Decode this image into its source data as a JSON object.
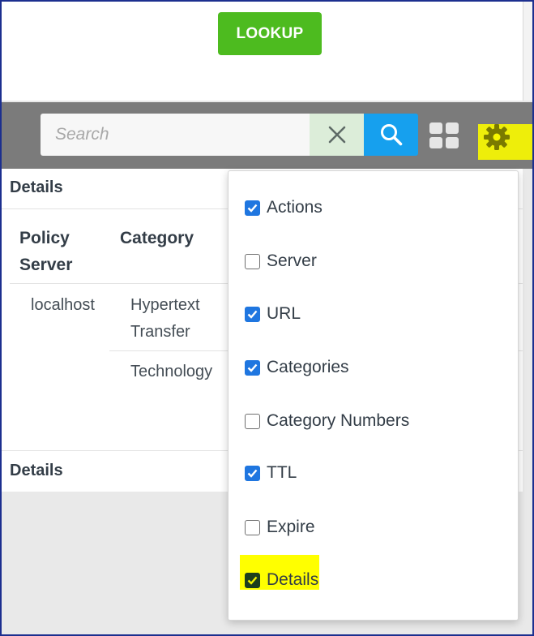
{
  "lookup_button": "LOOKUP",
  "search": {
    "placeholder": "Search"
  },
  "table": {
    "header_details": "Details",
    "columns": [
      "Policy Server",
      "Category"
    ],
    "rows": [
      {
        "policy_server": "localhost",
        "categories": [
          "Hypertext Transfer",
          "Technology"
        ]
      }
    ],
    "footer_details": "Details"
  },
  "column_menu": {
    "items": [
      {
        "label": "Actions",
        "checked": true
      },
      {
        "label": "Server",
        "checked": false
      },
      {
        "label": "URL",
        "checked": true
      },
      {
        "label": "Categories",
        "checked": true
      },
      {
        "label": "Category Numbers",
        "checked": false
      },
      {
        "label": "TTL",
        "checked": true
      },
      {
        "label": "Expire",
        "checked": false
      },
      {
        "label": "Details",
        "checked": true,
        "highlighted": true
      }
    ]
  },
  "icons": {
    "clear": "close-icon",
    "search": "search-icon",
    "grid": "grid-view-icon",
    "settings": "gear-icon"
  },
  "colors": {
    "lookup_button": "#4dbb1f",
    "search_button": "#16a0ee",
    "checkbox_checked": "#1f76e0",
    "highlight": "#ffff00",
    "toolbar": "#7b7b7b"
  }
}
